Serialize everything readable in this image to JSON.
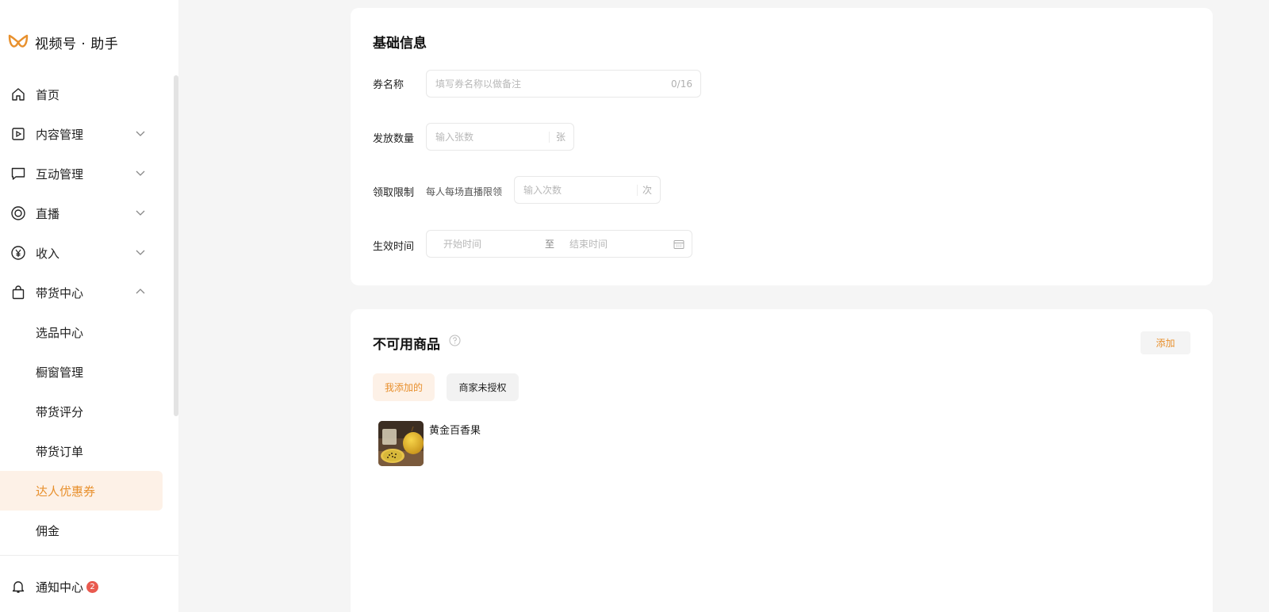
{
  "brand": {
    "name": "视频号 · 助手",
    "logo_color": "#e8902d"
  },
  "sidebar": {
    "items": [
      {
        "label": "首页",
        "icon": "home-icon",
        "expandable": false
      },
      {
        "label": "内容管理",
        "icon": "content-icon",
        "expandable": true,
        "expanded": false
      },
      {
        "label": "互动管理",
        "icon": "chat-icon",
        "expandable": true,
        "expanded": false
      },
      {
        "label": "直播",
        "icon": "live-icon",
        "expandable": true,
        "expanded": false
      },
      {
        "label": "收入",
        "icon": "yen-icon",
        "expandable": true,
        "expanded": false
      },
      {
        "label": "带货中心",
        "icon": "bag-icon",
        "expandable": true,
        "expanded": true
      },
      {
        "label": "选品中心",
        "sub": true
      },
      {
        "label": "橱窗管理",
        "sub": true
      },
      {
        "label": "带货评分",
        "sub": true
      },
      {
        "label": "带货订单",
        "sub": true
      },
      {
        "label": "达人优惠券",
        "sub": true,
        "active": true
      },
      {
        "label": "佣金",
        "sub": true
      }
    ],
    "notify": {
      "label": "通知中心",
      "count": "2",
      "icon": "bell-icon"
    }
  },
  "basic_info": {
    "title": "基础信息",
    "coupon_name": {
      "label": "券名称",
      "placeholder": "填写券名称以做备注",
      "counter": "0/16"
    },
    "quantity": {
      "label": "发放数量",
      "placeholder": "输入张数",
      "unit": "张"
    },
    "limit": {
      "label": "领取限制",
      "prefix": "每人每场直播限领",
      "placeholder": "输入次数",
      "unit": "次"
    },
    "valid_time": {
      "label": "生效时间",
      "start_placeholder": "开始时间",
      "separator": "至",
      "end_placeholder": "结束时间"
    }
  },
  "unavailable": {
    "title": "不可用商品",
    "add_label": "添加",
    "tabs": [
      {
        "label": "我添加的",
        "active": true
      },
      {
        "label": "商家未授权",
        "active": false
      }
    ],
    "products": [
      {
        "name": "黄金百香果"
      }
    ]
  },
  "colors": {
    "accent": "#e8902d",
    "accent_bg": "#fdf1e7",
    "badge": "#e95a4f",
    "page_bg": "#f5f5f5"
  }
}
